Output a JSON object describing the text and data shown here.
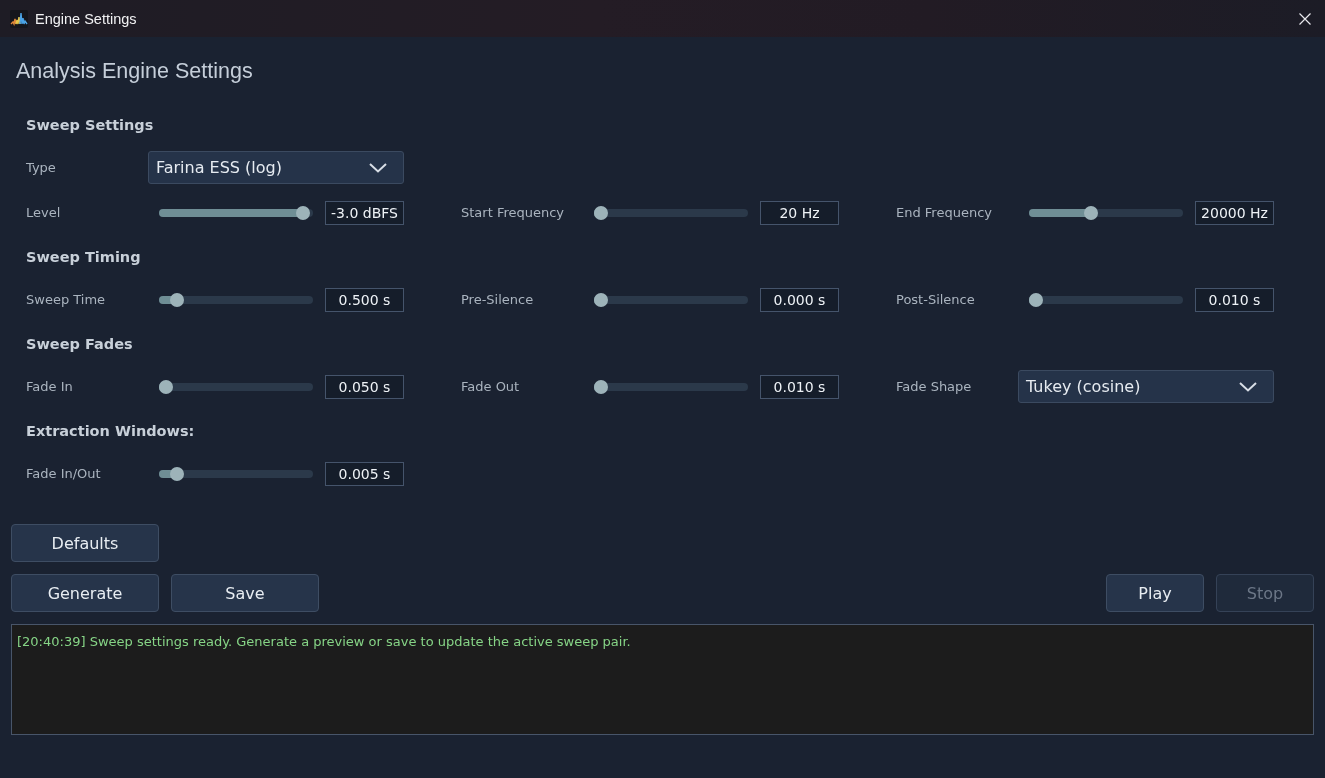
{
  "window": {
    "title": "Engine Settings"
  },
  "heading": "Analysis Engine Settings",
  "sections": [
    {
      "title": "Sweep Settings",
      "rows": [
        {
          "fields": [
            {
              "kind": "dropdown",
              "label": "Type",
              "value": "Farina ESS (log)"
            }
          ]
        },
        {
          "fields": [
            {
              "kind": "slider",
              "label": "Level",
              "level": 0.98,
              "reading": "-3.0 dBFS"
            },
            {
              "kind": "slider",
              "label": "Start Frequency",
              "level": 0,
              "reading": "20 Hz"
            },
            {
              "kind": "slider",
              "label": "End Frequency",
              "level": 0.39,
              "reading": "20000 Hz"
            }
          ]
        }
      ]
    },
    {
      "title": "Sweep Timing",
      "rows": [
        {
          "fields": [
            {
              "kind": "slider",
              "label": "Sweep Time",
              "level": 0.08,
              "reading": "0.500 s"
            },
            {
              "kind": "slider",
              "label": "Pre-Silence",
              "level": 0,
              "reading": "0.000 s"
            },
            {
              "kind": "slider",
              "label": "Post-Silence",
              "level": 0,
              "reading": "0.010 s"
            }
          ]
        }
      ]
    },
    {
      "title": "Sweep Fades",
      "rows": [
        {
          "fields": [
            {
              "kind": "slider",
              "label": "Fade In",
              "level": 0,
              "reading": "0.050 s"
            },
            {
              "kind": "slider",
              "label": "Fade Out",
              "level": 0,
              "reading": "0.010 s"
            },
            {
              "kind": "dropdown",
              "label": "Fade Shape",
              "value": "Tukey (cosine)"
            }
          ]
        }
      ]
    },
    {
      "title": "Extraction Windows:",
      "rows": [
        {
          "fields": [
            {
              "kind": "slider",
              "label": "Fade In/Out",
              "level": 0.08,
              "reading": "0.005 s"
            }
          ]
        }
      ]
    }
  ],
  "button_rows": [
    {
      "left": [
        {
          "label": "Defaults",
          "disabled": false
        }
      ]
    },
    {
      "left": [
        {
          "label": "Generate",
          "disabled": false
        },
        {
          "label": "Save",
          "disabled": false
        }
      ],
      "right": [
        {
          "label": "Play",
          "disabled": false
        },
        {
          "label": "Stop",
          "disabled": true
        }
      ]
    }
  ],
  "log": {
    "lines": [
      "[20:40:39] Sweep settings ready. Generate a preview or save to update the active sweep pair."
    ]
  }
}
